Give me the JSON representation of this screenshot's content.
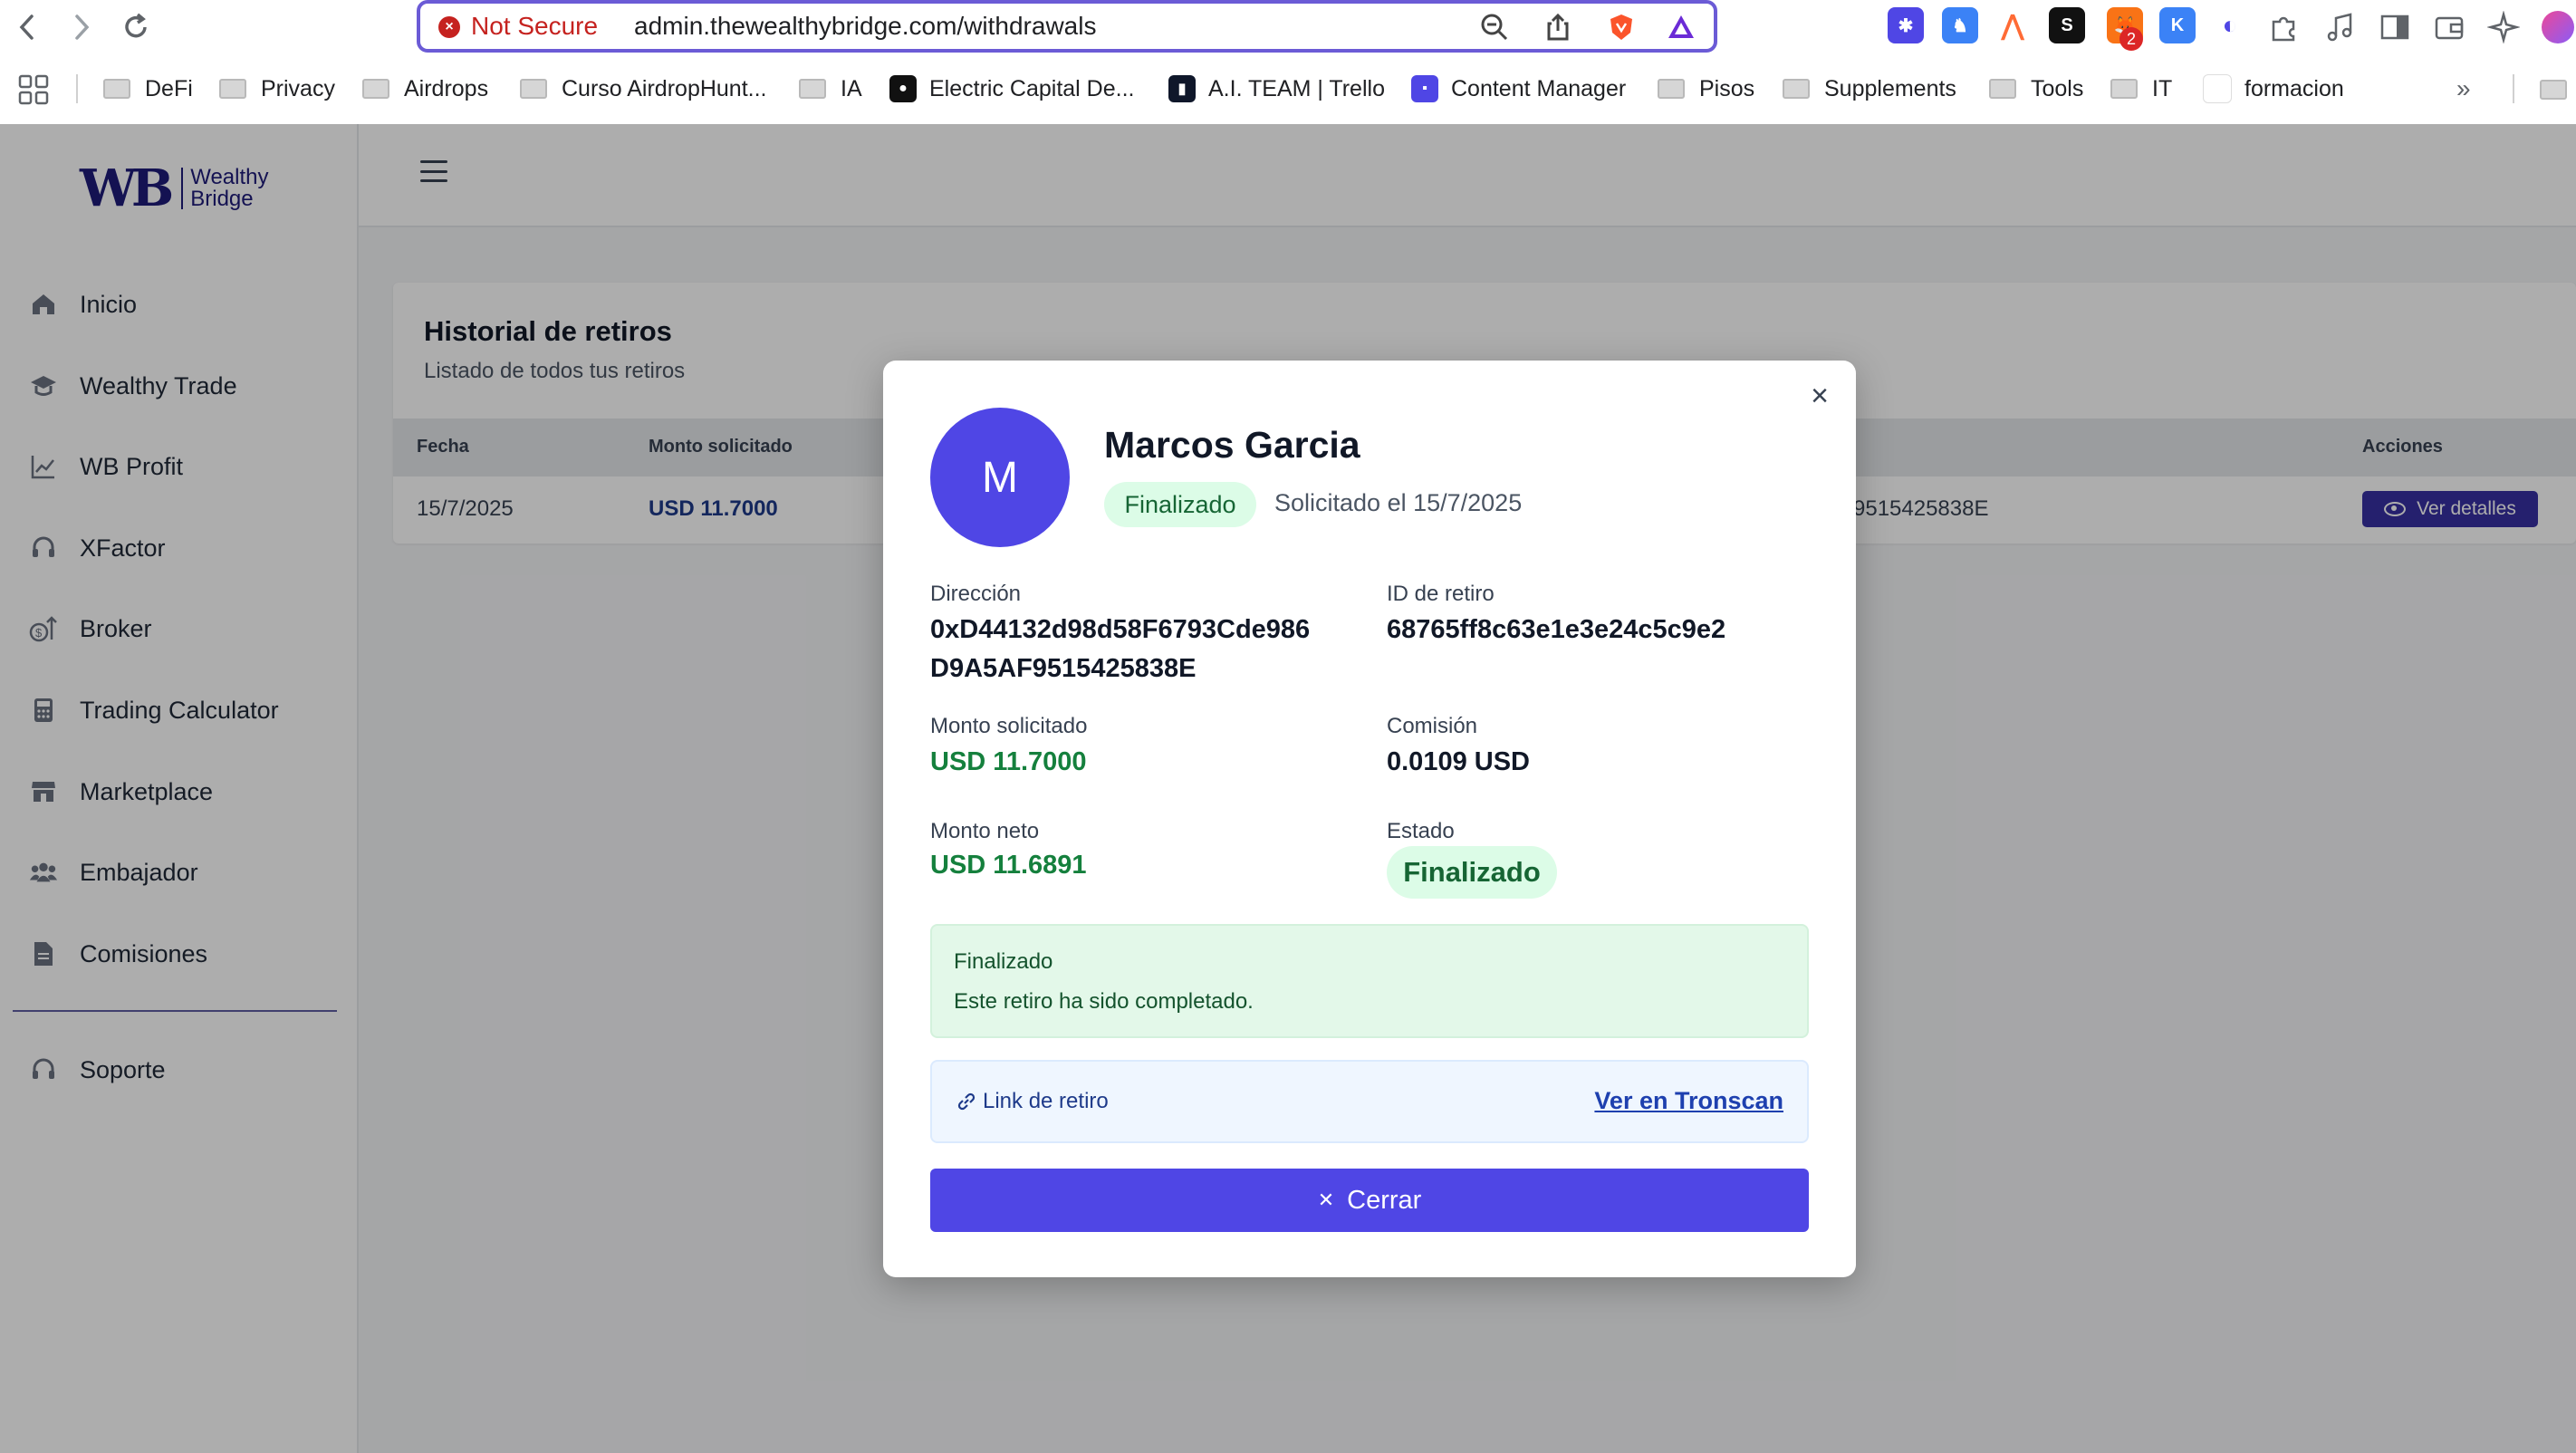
{
  "browser": {
    "security_label": "Not Secure",
    "url": "admin.thewealthybridge.com/withdrawals",
    "bookmarks": [
      {
        "label": "DeFi",
        "icon": "folder-icon"
      },
      {
        "label": "Privacy",
        "icon": "folder-icon"
      },
      {
        "label": "Airdrops",
        "icon": "folder-icon"
      },
      {
        "label": "Curso AirdropHunt...",
        "icon": "folder-icon"
      },
      {
        "label": "IA",
        "icon": "folder-icon"
      },
      {
        "label": "Electric Capital De...",
        "icon": "medium-icon"
      },
      {
        "label": "A.I. TEAM | Trello",
        "icon": "trello-icon"
      },
      {
        "label": "Content Manager",
        "icon": "app-icon"
      },
      {
        "label": "Pisos",
        "icon": "folder-icon"
      },
      {
        "label": "Supplements",
        "icon": "folder-icon"
      },
      {
        "label": "Tools",
        "icon": "folder-icon"
      },
      {
        "label": "IT",
        "icon": "folder-icon"
      },
      {
        "label": "formacion",
        "icon": "page-icon"
      }
    ],
    "extension_badge": "2"
  },
  "sidebar": {
    "logo_text_1": "Wealthy",
    "logo_text_2": "Bridge",
    "items": [
      {
        "label": "Inicio",
        "icon": "home-icon"
      },
      {
        "label": "Wealthy Trade",
        "icon": "graduation-cap-icon"
      },
      {
        "label": "WB Profit",
        "icon": "chart-line-icon"
      },
      {
        "label": "XFactor",
        "icon": "headset-icon"
      },
      {
        "label": "Broker",
        "icon": "money-icon"
      },
      {
        "label": "Trading Calculator",
        "icon": "calculator-icon"
      },
      {
        "label": "Marketplace",
        "icon": "store-icon"
      },
      {
        "label": "Embajador",
        "icon": "users-icon"
      },
      {
        "label": "Comisiones",
        "icon": "document-icon"
      },
      {
        "label": "Soporte",
        "icon": "headset-icon"
      }
    ]
  },
  "history": {
    "title": "Historial de retiros",
    "subtitle": "Listado de todos tus retiros",
    "columns": [
      "Fecha",
      "Monto solicitado",
      "Acciones"
    ],
    "row": {
      "date": "15/7/2025",
      "amount": "USD 11.7000",
      "address_fragment": "9515425838E",
      "action": "Ver detalles"
    }
  },
  "modal": {
    "avatar_letter": "M",
    "name": "Marcos Garcia",
    "status": "Finalizado",
    "requested_on": "Solicitado el 15/7/2025",
    "fields": {
      "address_label": "Dirección",
      "address_line1": "0xD44132d98d58F6793Cde986",
      "address_line2": "D9A5AF9515425838E",
      "id_label": "ID de retiro",
      "id_value": "68765ff8c63e1e3e24c5c9e2",
      "requested_label": "Monto solicitado",
      "requested_value": "USD 11.7000",
      "fee_label": "Comisión",
      "fee_value": "0.0109 USD",
      "net_label": "Monto neto",
      "net_value": "USD 11.6891",
      "state_label": "Estado",
      "state_value": "Finalizado"
    },
    "notice": {
      "title": "Finalizado",
      "body": "Este retiro ha sido completado."
    },
    "link": {
      "label": "Link de retiro",
      "action": "Ver en Tronscan"
    },
    "close_label": "Cerrar"
  },
  "colors": {
    "accent": "#4f46e5",
    "brand": "#1e1b7a",
    "success": "#15803d",
    "success_bg": "#dcfce7"
  }
}
